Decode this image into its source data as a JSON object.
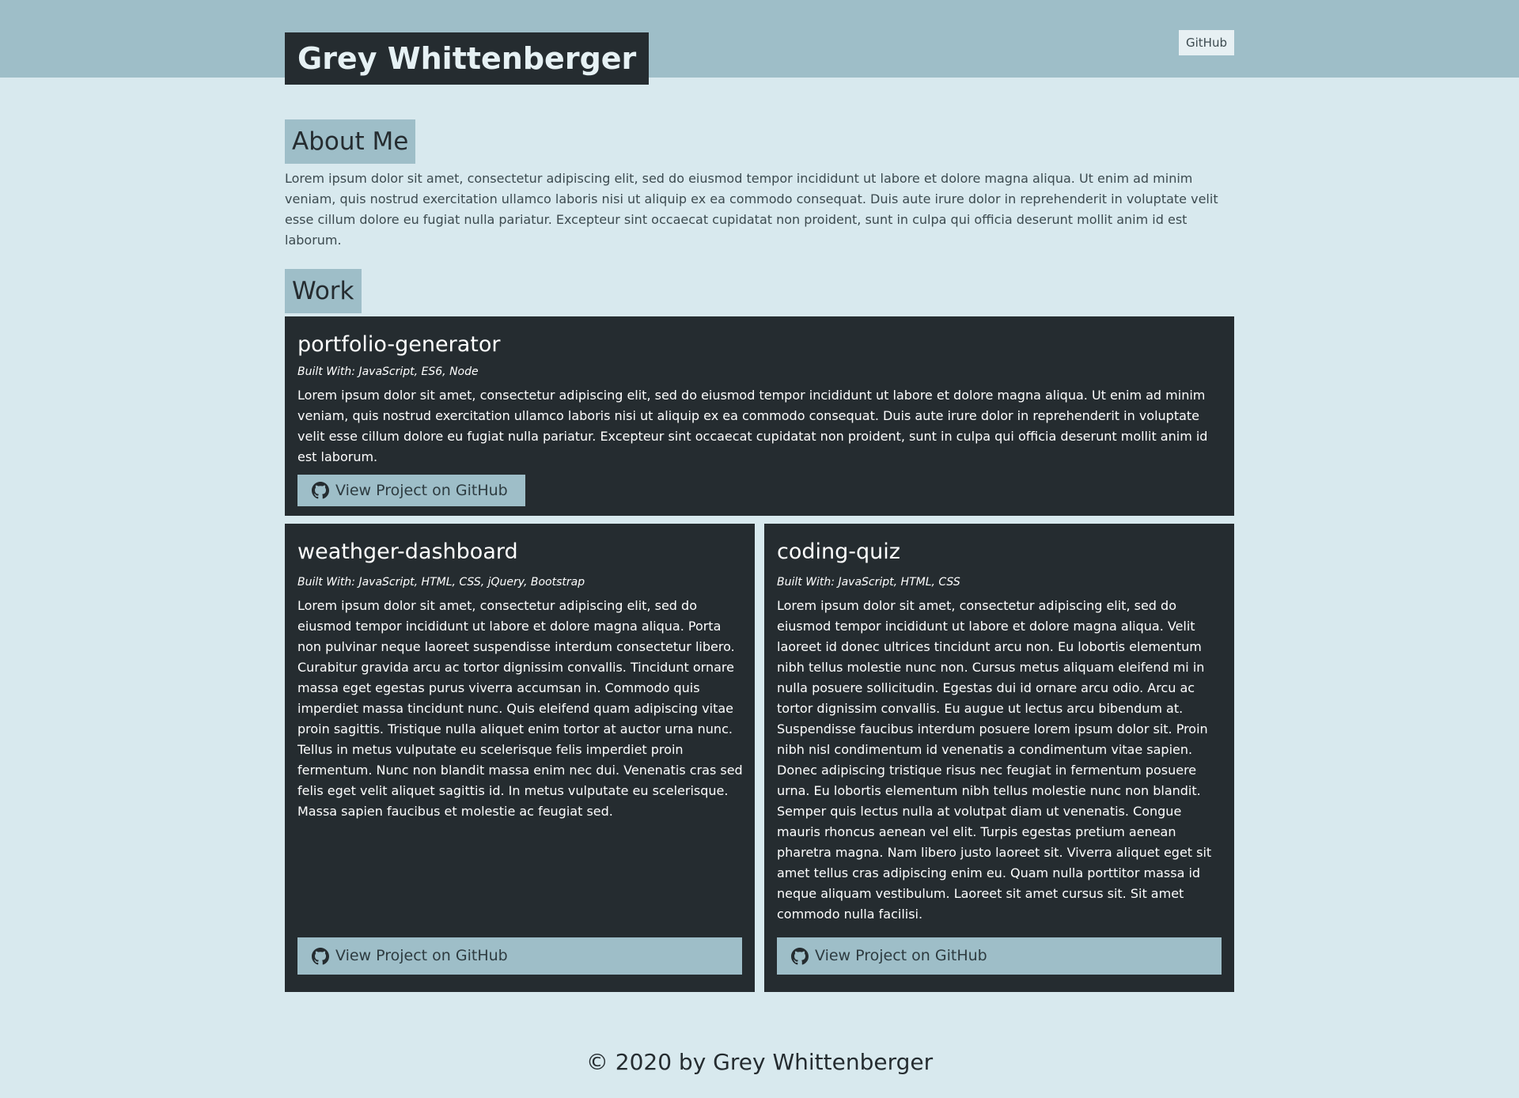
{
  "header": {
    "title": "Grey Whittenberger",
    "nav_github": "GitHub"
  },
  "about": {
    "heading": "About Me",
    "text": "Lorem ipsum dolor sit amet, consectetur adipiscing elit, sed do eiusmod tempor incididunt ut labore et dolore magna aliqua. Ut enim ad minim veniam, quis nostrud exercitation ullamco laboris nisi ut aliquip ex ea commodo consequat. Duis aute irure dolor in reprehenderit in voluptate velit esse cillum dolore eu fugiat nulla pariatur. Excepteur sint occaecat cupidatat non proident, sunt in culpa qui officia deserunt mollit anim id est laborum."
  },
  "work": {
    "heading": "Work",
    "projects": [
      {
        "title": "portfolio-generator",
        "built_with": "Built With: JavaScript, ES6, Node",
        "description": "Lorem ipsum dolor sit amet, consectetur adipiscing elit, sed do eiusmod tempor incididunt ut labore et dolore magna aliqua. Ut enim ad minim veniam, quis nostrud exercitation ullamco laboris nisi ut aliquip ex ea commodo consequat. Duis aute irure dolor in reprehenderit in voluptate velit esse cillum dolore eu fugiat nulla pariatur. Excepteur sint occaecat cupidatat non proident, sunt in culpa qui officia deserunt mollit anim id est laborum.",
        "button": "View Project on GitHub"
      },
      {
        "title": "weathger-dashboard",
        "built_with": "Built With: JavaScript, HTML, CSS, jQuery, Bootstrap",
        "description": "Lorem ipsum dolor sit amet, consectetur adipiscing elit, sed do eiusmod tempor incididunt ut labore et dolore magna aliqua. Porta non pulvinar neque laoreet suspendisse interdum consectetur libero. Curabitur gravida arcu ac tortor dignissim convallis. Tincidunt ornare massa eget egestas purus viverra accumsan in. Commodo quis imperdiet massa tincidunt nunc. Quis eleifend quam adipiscing vitae proin sagittis. Tristique nulla aliquet enim tortor at auctor urna nunc. Tellus in metus vulputate eu scelerisque felis imperdiet proin fermentum. Nunc non blandit massa enim nec dui. Venenatis cras sed felis eget velit aliquet sagittis id. In metus vulputate eu scelerisque. Massa sapien faucibus et molestie ac feugiat sed.",
        "button": "View Project on GitHub"
      },
      {
        "title": "coding-quiz",
        "built_with": "Built With: JavaScript, HTML, CSS",
        "description": "Lorem ipsum dolor sit amet, consectetur adipiscing elit, sed do eiusmod tempor incididunt ut labore et dolore magna aliqua. Velit laoreet id donec ultrices tincidunt arcu non. Eu lobortis elementum nibh tellus molestie nunc non. Cursus metus aliquam eleifend mi in nulla posuere sollicitudin. Egestas dui id ornare arcu odio. Arcu ac tortor dignissim convallis. Eu augue ut lectus arcu bibendum at. Suspendisse faucibus interdum posuere lorem ipsum dolor sit. Proin nibh nisl condimentum id venenatis a condimentum vitae sapien. Donec adipiscing tristique risus nec feugiat in fermentum posuere urna. Eu lobortis elementum nibh tellus molestie nunc non blandit. Semper quis lectus nulla at volutpat diam ut venenatis. Congue mauris rhoncus aenean vel elit. Turpis egestas pretium aenean pharetra magna. Nam libero justo laoreet sit. Viverra aliquet eget sit amet tellus cras adipiscing enim eu. Quam nulla porttitor massa id neque aliquam vestibulum. Laoreet sit amet cursus sit. Sit amet commodo nulla facilisi.",
        "button": "View Project on GitHub"
      }
    ]
  },
  "footer": {
    "text": "© 2020 by Grey Whittenberger"
  },
  "icons": {
    "project_button_icon": "github-icon"
  },
  "colors": {
    "background": "#d8e9ee",
    "header": "#9ebec8",
    "card": "#252c30",
    "accent": "#9ebec8"
  }
}
